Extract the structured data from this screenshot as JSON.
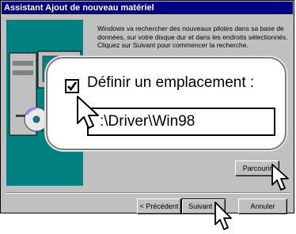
{
  "window": {
    "title": "Assistant Ajout de nouveau matériel"
  },
  "description": "Windows va rechercher des nouveaux pilotes dans sa base de données, sur votre disque dur et dans les endroits sélectionnés. Cliquez sur Suivant pour commencer la recherche.",
  "location": {
    "checkbox_label": "Définir un emplacement :",
    "checked": true,
    "path": ":\\Driver\\Win98"
  },
  "buttons": {
    "browse": "Parcourir",
    "previous": "< Précédent",
    "next": "Suivant >",
    "cancel": "Annuler"
  },
  "icons": [
    "computer-icon",
    "cd-disc-icon",
    "checkbox-checkmark-icon",
    "mouse-pointer-icon"
  ]
}
